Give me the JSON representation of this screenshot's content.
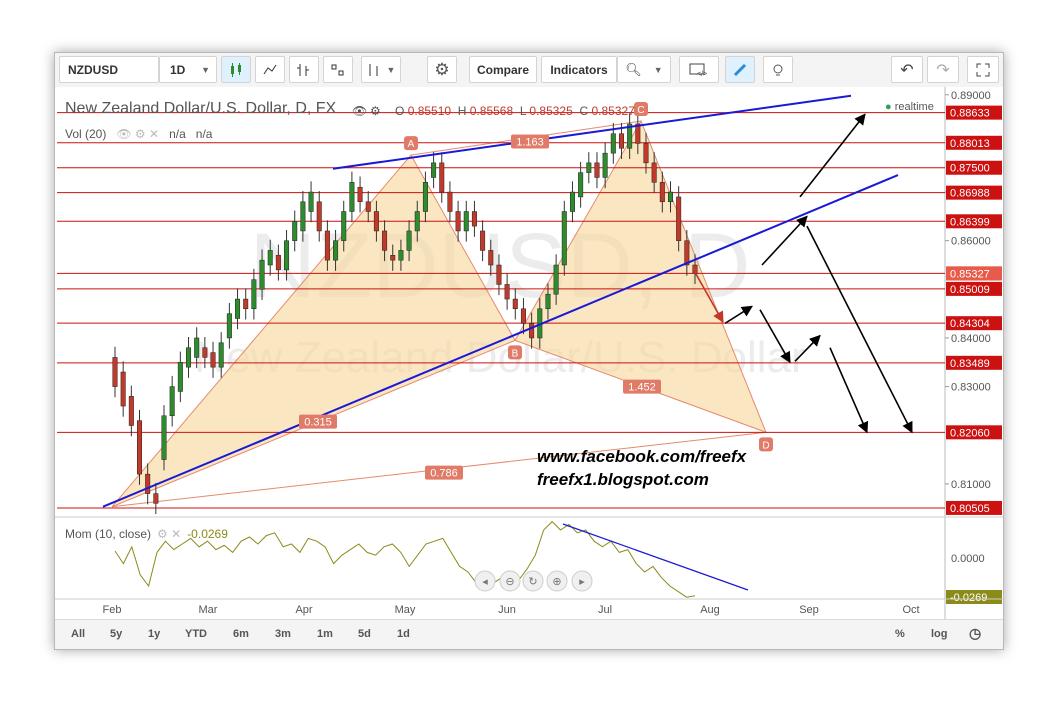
{
  "toolbar": {
    "symbol": "NZDUSD",
    "interval": "1D",
    "compare": "Compare",
    "indicators": "Indicators"
  },
  "legend": {
    "title": "New Zealand Dollar/U.S. Dollar, D, FX",
    "o_label": "O",
    "o": "0.85510",
    "h_label": "H",
    "h": "0.85568",
    "l_label": "L",
    "l": "0.85325",
    "c_label": "C",
    "c": "0.85327",
    "vol": "Vol (20)",
    "na1": "n/a",
    "na2": "n/a",
    "realtime": "realtime",
    "mom": "Mom (10, close)",
    "mom_value": "-0.0269"
  },
  "watermark": {
    "symbol": "NZDUSD, D",
    "name": "New Zealand Dollar/U.S. Dollar"
  },
  "credits": {
    "line1": "www.facebook.com/freefx",
    "line2": "freefx1.blogspot.com"
  },
  "colors": {
    "up": "#2e8b2e",
    "down": "#c0392b",
    "trend": "#1a1ad6",
    "level": "#cc1111",
    "pattern_fill": "#f7d9a0",
    "pattern_edge": "#e48b6d",
    "momentum": "#8b8b1a"
  },
  "chart_data": {
    "type": "candlestick",
    "symbol": "NZDUSD",
    "timeframe": "D",
    "x_labels": [
      "Feb",
      "Mar",
      "Apr",
      "May",
      "Jun",
      "Jul",
      "Aug",
      "Sep",
      "Oct"
    ],
    "y_ticks": [
      "0.89000",
      "0.87000",
      "0.86000",
      "0.84000",
      "0.83000",
      "0.81000"
    ],
    "ylim": [
      0.8036,
      0.8916
    ],
    "last_price": "0.85327",
    "horizontal_levels": [
      {
        "price": 0.88633,
        "label": "0.88633"
      },
      {
        "price": 0.88013,
        "label": "0.88013"
      },
      {
        "price": 0.875,
        "label": "0.87500"
      },
      {
        "price": 0.86988,
        "label": "0.86988"
      },
      {
        "price": 0.86399,
        "label": "0.86399"
      },
      {
        "price": 0.85327,
        "label": "0.85327"
      },
      {
        "price": 0.85009,
        "label": "0.85009"
      },
      {
        "price": 0.84304,
        "label": "0.84304"
      },
      {
        "price": 0.83489,
        "label": "0.83489"
      },
      {
        "price": 0.8206,
        "label": "0.82060"
      },
      {
        "price": 0.80505,
        "label": "0.80505"
      }
    ],
    "pattern_points": [
      {
        "label": "A",
        "date": "May",
        "price": 0.8776
      },
      {
        "label": "B",
        "date": "Jun",
        "price": 0.8395
      },
      {
        "label": "C",
        "date": "Jul",
        "price": 0.8846
      },
      {
        "label": "D",
        "date": "Aug",
        "price": 0.8206
      }
    ],
    "fib_ratios": [
      "1.163",
      "1.452",
      "0.315",
      "0.786"
    ],
    "momentum": {
      "name": "Mom (10, close)",
      "value": "-0.0269",
      "tick": "0.0000"
    },
    "time_ranges": [
      "All",
      "5y",
      "1y",
      "YTD",
      "6m",
      "3m",
      "1m",
      "5d",
      "1d"
    ],
    "scale_buttons": [
      "%",
      "log"
    ]
  }
}
